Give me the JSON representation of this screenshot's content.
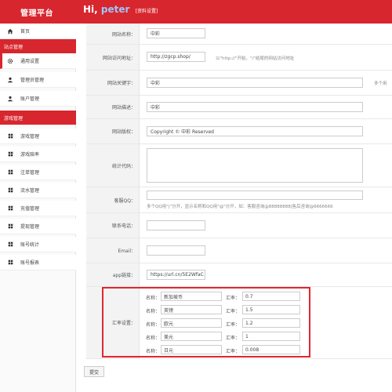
{
  "header": {
    "brand": "管理平台",
    "greeting": "Hi,",
    "user": "peter",
    "profile_link": "[资料设置]"
  },
  "sidebar": {
    "home": "首页",
    "section1": "站点管理",
    "items1": [
      "通用设置",
      "管理员管理",
      "账户管理"
    ],
    "section2": "游戏管理",
    "items2": [
      "游戏管理",
      "游戏赔率",
      "注单管理",
      "流水管理",
      "充值管理",
      "提现管理",
      "账号统计",
      "账号报表"
    ]
  },
  "form": {
    "site_name_label": "网站名称：",
    "site_name_value": "中彩",
    "site_url_label": "网站访问地址：",
    "site_url_value": "http://zgcp.shop/",
    "site_url_hint": "以\"http://\"开始，\"/\"结尾的网站访问地址",
    "keywords_label": "网站关键字：",
    "keywords_value": "中彩",
    "keywords_hint": "多个用",
    "description_label": "网站描述：",
    "description_value": "中彩",
    "copyright_label": "网站版权：",
    "copyright_value": "Copyright © 中彩 Reserved",
    "stats_label": "统计代码：",
    "qq_label": "客服QQ：",
    "qq_hint": "多个QQ用\"|\"分开，显示名称和QQ用\"@\"分开，如：客服咨询@88888888|售后咨询@6666666",
    "phone_label": "联系电话：",
    "email_label": "Email：",
    "app_label": "app链接：",
    "app_value": "https://url.cn/5E2WfaC",
    "rate_label": "汇率设置：",
    "name_label": "名称：",
    "rate_item_label": "汇率：",
    "rates": [
      {
        "name": "新加坡币",
        "rate": "0.7"
      },
      {
        "name": "英镑",
        "rate": "1.5"
      },
      {
        "name": "欧元",
        "rate": "1.2"
      },
      {
        "name": "美元",
        "rate": "1"
      },
      {
        "name": "日元",
        "rate": "0.008"
      }
    ],
    "submit": "提交"
  },
  "colors": {
    "accent": "#d8262e",
    "highlight_border": "#e0262f",
    "user_link": "#9bc7ff"
  }
}
